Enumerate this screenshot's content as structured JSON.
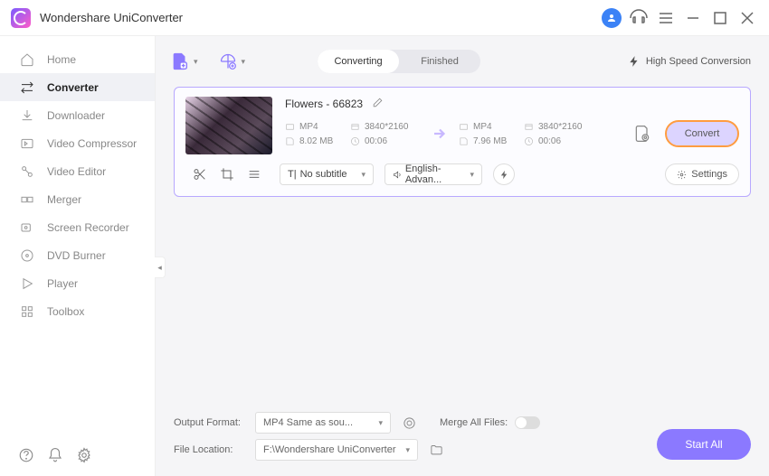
{
  "app": {
    "title": "Wondershare UniConverter"
  },
  "sidebar": {
    "items": [
      {
        "label": "Home"
      },
      {
        "label": "Converter"
      },
      {
        "label": "Downloader"
      },
      {
        "label": "Video Compressor"
      },
      {
        "label": "Video Editor"
      },
      {
        "label": "Merger"
      },
      {
        "label": "Screen Recorder"
      },
      {
        "label": "DVD Burner"
      },
      {
        "label": "Player"
      },
      {
        "label": "Toolbox"
      }
    ]
  },
  "tabs": {
    "converting": "Converting",
    "finished": "Finished"
  },
  "speed": "High Speed Conversion",
  "file": {
    "name": "Flowers - 66823",
    "src": {
      "format": "MP4",
      "resolution": "3840*2160",
      "size": "8.02 MB",
      "duration": "00:06"
    },
    "dst": {
      "format": "MP4",
      "resolution": "3840*2160",
      "size": "7.96 MB",
      "duration": "00:06"
    },
    "convert": "Convert",
    "subtitle": "No subtitle",
    "audio": "English-Advan...",
    "settings": "Settings"
  },
  "bottom": {
    "format_label": "Output Format:",
    "format_value": "MP4 Same as sou...",
    "location_label": "File Location:",
    "location_value": "F:\\Wondershare UniConverter",
    "merge_label": "Merge All Files:",
    "start_all": "Start All"
  }
}
